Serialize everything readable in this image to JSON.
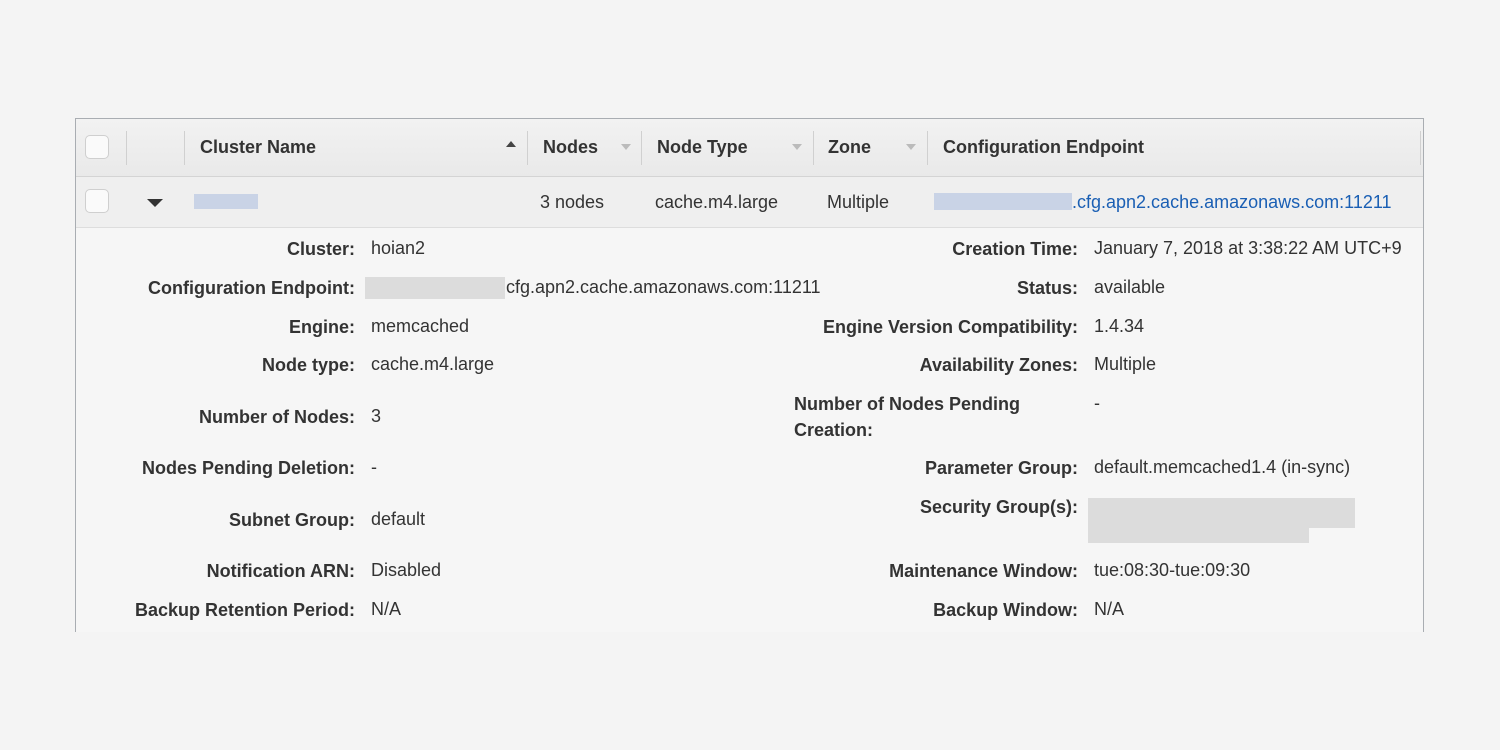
{
  "table": {
    "columns": {
      "cluster_name": "Cluster Name",
      "nodes": "Nodes",
      "node_type": "Node Type",
      "zone": "Zone",
      "config_endpoint": "Configuration Endpoint"
    },
    "row": {
      "nodes": "3 nodes",
      "node_type": "cache.m4.large",
      "zone": "Multiple",
      "endpoint": ".cfg.apn2.cache.amazonaws.com:11211"
    }
  },
  "details": {
    "left": {
      "cluster_label": "Cluster:",
      "cluster_value": "hoian2",
      "endpoint_label": "Configuration Endpoint:",
      "endpoint_value": "cfg.apn2.cache.amazonaws.com:11211",
      "engine_label": "Engine:",
      "engine_value": "memcached",
      "node_type_label": "Node type:",
      "node_type_value": "cache.m4.large",
      "num_nodes_label": "Number of Nodes:",
      "num_nodes_value": "3",
      "pending_deletion_label": "Nodes Pending Deletion:",
      "pending_deletion_value": "-",
      "subnet_label": "Subnet Group:",
      "subnet_value": "default",
      "notification_label": "Notification ARN:",
      "notification_value": "Disabled",
      "backup_retention_label": "Backup Retention Period:",
      "backup_retention_value": "N/A"
    },
    "right": {
      "creation_label": "Creation Time:",
      "creation_value": "January 7, 2018 at 3:38:22 AM UTC+9",
      "status_label": "Status:",
      "status_value": "available",
      "engine_version_label": "Engine Version Compatibility:",
      "engine_version_value": "1.4.34",
      "az_label": "Availability Zones:",
      "az_value": "Multiple",
      "pending_creation_label_1": "Number of Nodes Pending",
      "pending_creation_label_2": "Creation:",
      "pending_creation_value": "-",
      "param_group_label": "Parameter Group:",
      "param_group_value": "default.memcached1.4 (in-sync)",
      "security_label": "Security Group(s):",
      "maintenance_label": "Maintenance Window:",
      "maintenance_value": "tue:08:30-tue:09:30",
      "backup_window_label": "Backup Window:",
      "backup_window_value": "N/A"
    }
  },
  "colors": {
    "link": "#1a5fb4",
    "redaction_blue": "#c9d3e6",
    "redaction_gray": "#dcdcdc"
  }
}
